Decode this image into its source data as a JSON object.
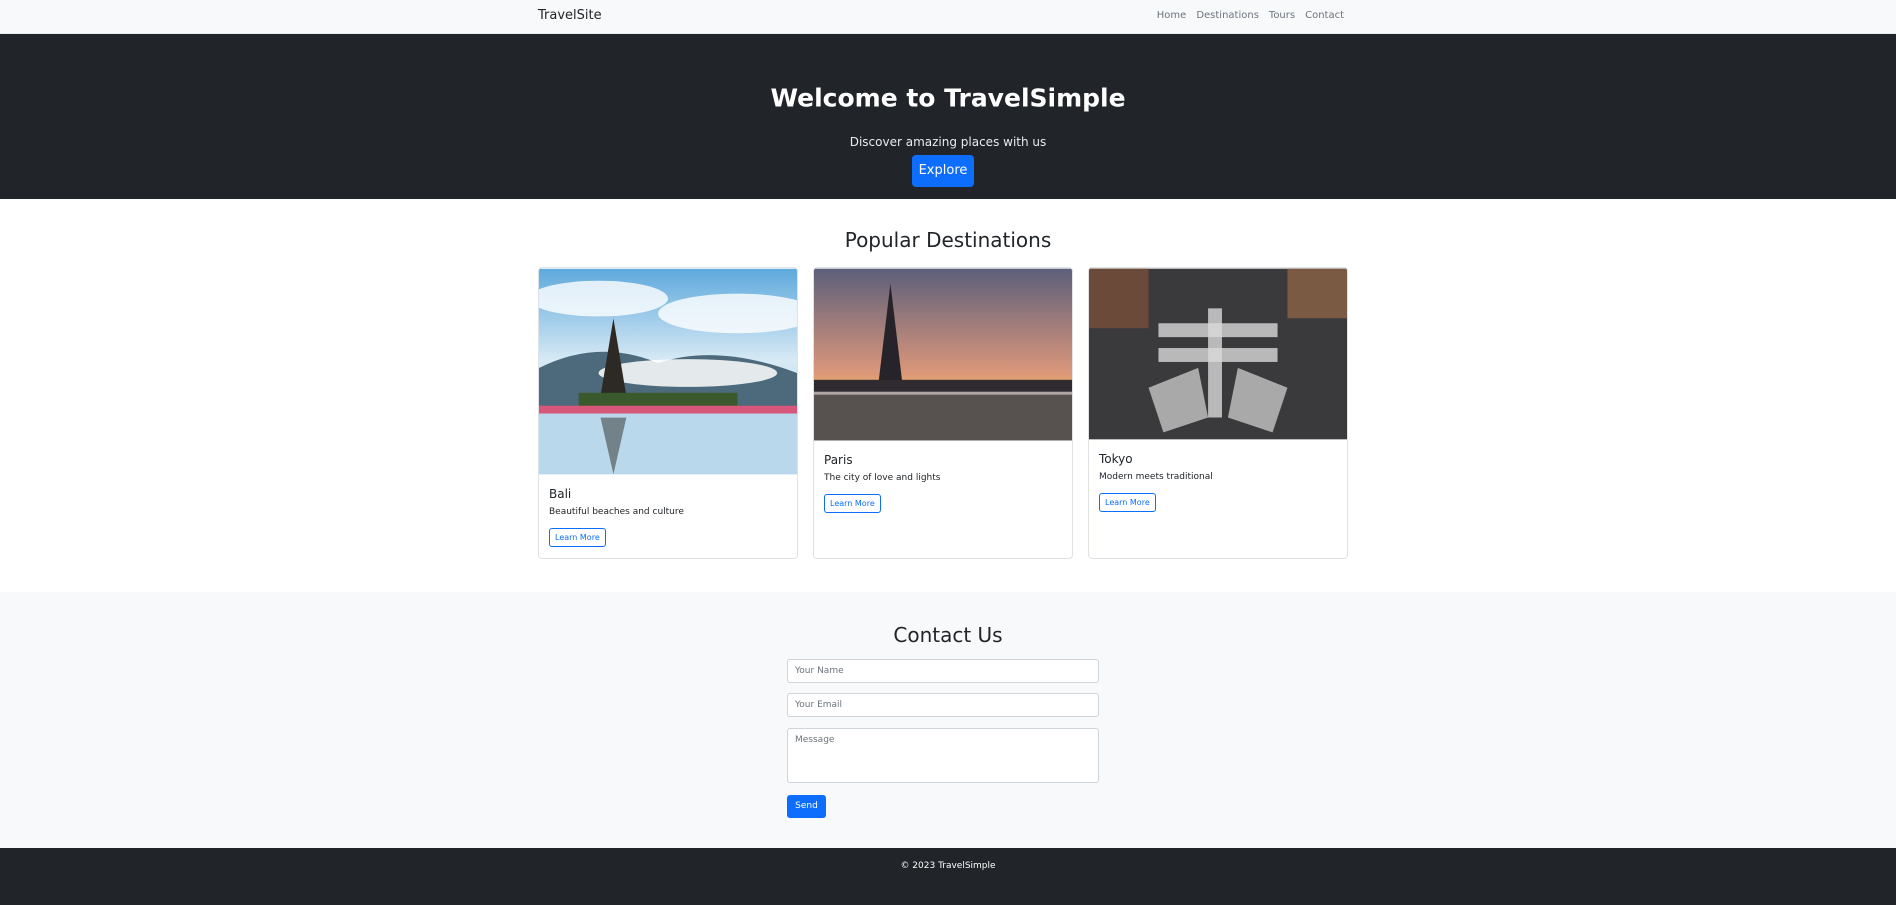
{
  "navbar": {
    "brand": "TravelSite",
    "links": [
      "Home",
      "Destinations",
      "Tours",
      "Contact"
    ]
  },
  "hero": {
    "title": "Welcome to TravelSimple",
    "subtitle": "Discover amazing places with us",
    "button": "Explore"
  },
  "destinations": {
    "heading": "Popular Destinations",
    "cards": [
      {
        "title": "Bali",
        "description": "Beautiful beaches and culture",
        "button": "Learn More"
      },
      {
        "title": "Paris",
        "description": "The city of love and lights",
        "button": "Learn More"
      },
      {
        "title": "Tokyo",
        "description": "Modern meets traditional",
        "button": "Learn More"
      }
    ]
  },
  "contact": {
    "heading": "Contact Us",
    "name_placeholder": "Your Name",
    "email_placeholder": "Your Email",
    "message_placeholder": "Message",
    "send_button": "Send"
  },
  "footer": {
    "text": "© 2023 TravelSimple"
  },
  "colors": {
    "primary": "#0d6efd",
    "dark": "#212529",
    "light": "#f8f9fa"
  }
}
